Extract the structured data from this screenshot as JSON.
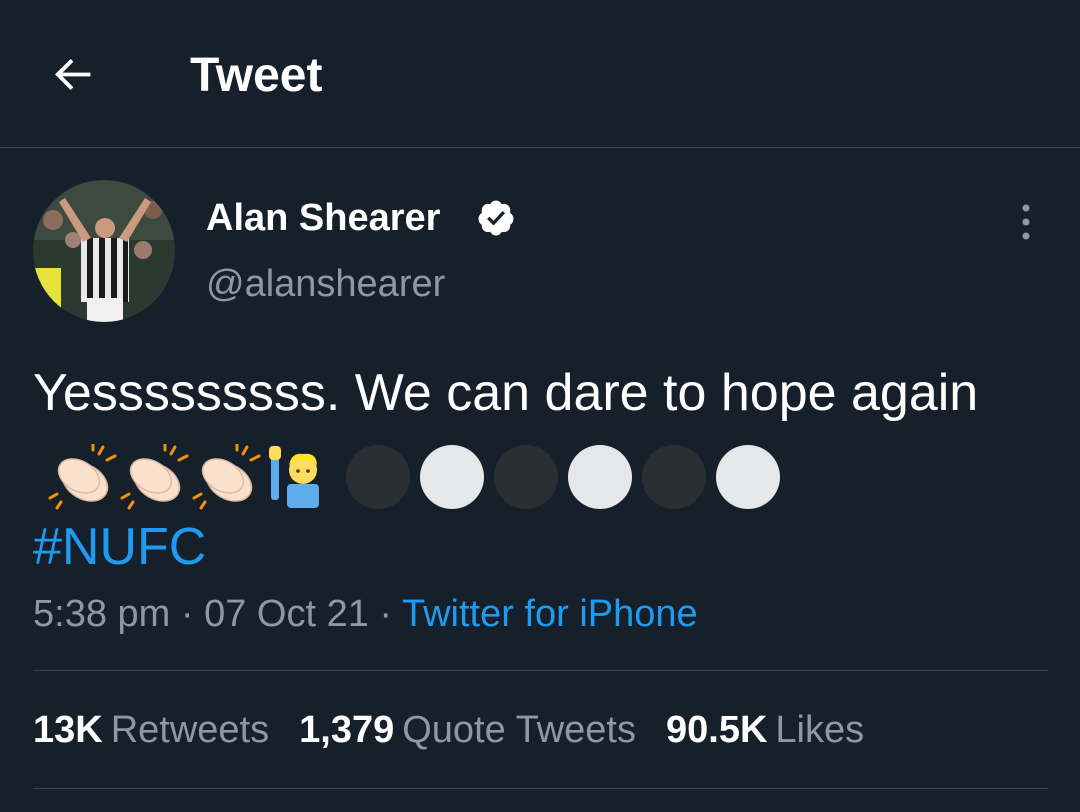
{
  "header": {
    "title": "Tweet",
    "back_icon": "arrow-left-icon"
  },
  "author": {
    "display_name": "Alan Shearer",
    "handle": "@alanshearer",
    "verified": true,
    "verified_icon": "verified-badge-icon",
    "avatar": "avatar-photo"
  },
  "tweet": {
    "text": "Yesssssssss. We can dare to hope again",
    "emojis": [
      "clapping-hands-icon",
      "clapping-hands-icon",
      "clapping-hands-icon",
      "person-raising-hand-icon",
      "black-circle-icon",
      "white-circle-icon",
      "black-circle-icon",
      "white-circle-icon",
      "black-circle-icon",
      "white-circle-icon"
    ],
    "hashtag": "#NUFC"
  },
  "meta": {
    "time": "5:38 pm",
    "separator": "·",
    "date": "07 Oct 21",
    "source": "Twitter for iPhone"
  },
  "stats": {
    "retweets_count": "13K",
    "retweets_label": "Retweets",
    "quotes_count": "1,379",
    "quotes_label": "Quote Tweets",
    "likes_count": "90.5K",
    "likes_label": "Likes"
  },
  "colors": {
    "background": "#15202b",
    "accent": "#1d9bf0",
    "secondary_text": "#8b98a5",
    "divider": "#38444d"
  }
}
